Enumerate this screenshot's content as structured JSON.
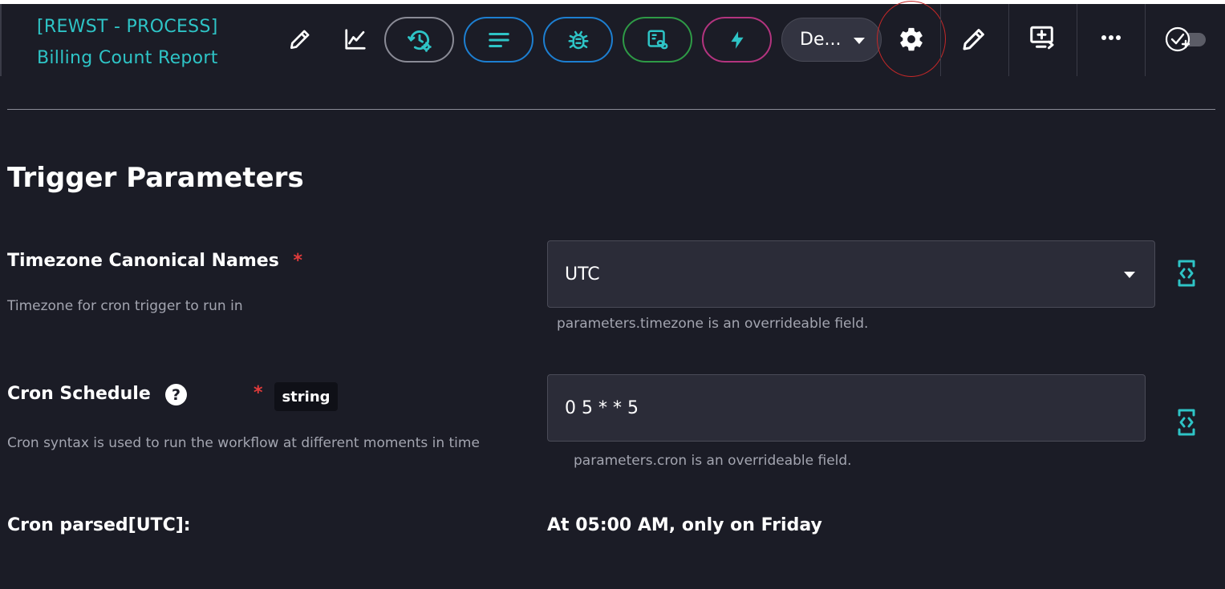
{
  "header": {
    "title_line1": "[REWST - PROCESS]",
    "title_line2": "Billing Count Report",
    "environment_select": "De...",
    "accent_color": "#2ec4c6",
    "pill_colors": {
      "history": "#8a8b96",
      "logs": "#1d7fd1",
      "debug": "#1d7fd1",
      "options": "#2e9a46",
      "triggers": "#b3347f"
    },
    "icons": [
      "pencil-icon",
      "chart-icon",
      "history-settings-icon",
      "lines-icon",
      "bug-icon",
      "linked-form-icon",
      "lightning-icon",
      "gear-icon",
      "pencil-icon",
      "add-monitor-icon",
      "more-icon",
      "check-add-toggle-icon"
    ]
  },
  "section": {
    "title": "Trigger Parameters"
  },
  "timezone": {
    "label": "Timezone Canonical Names",
    "required_mark": "*",
    "description": "Timezone for cron trigger to run in",
    "value": "UTC",
    "hint": "parameters.timezone is an overrideable field."
  },
  "cron": {
    "label": "Cron Schedule",
    "help": "?",
    "required_mark": "*",
    "type_badge": "string",
    "description": "Cron syntax is used to run the workflow at different moments in time",
    "value": "0 5 * * 5",
    "hint": "parameters.cron is an overrideable field."
  },
  "parsed": {
    "label": "Cron parsed[UTC]:",
    "value": "At 05:00 AM, only on Friday"
  }
}
